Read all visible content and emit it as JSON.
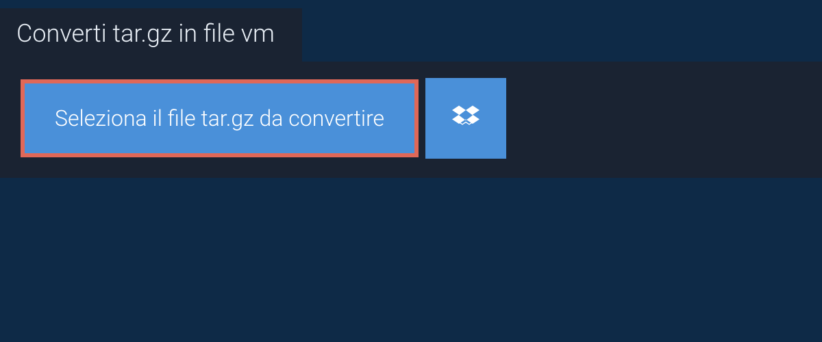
{
  "header": {
    "title": "Converti tar.gz in file vm"
  },
  "actions": {
    "select_file_label": "Seleziona il file tar.gz da convertire",
    "dropbox_icon_name": "dropbox-icon"
  }
}
